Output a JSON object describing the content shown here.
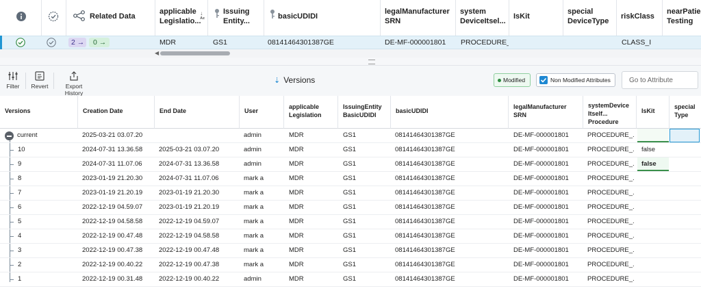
{
  "top_grid": {
    "headers": [
      {
        "label": "",
        "icon": "info-icon"
      },
      {
        "label": "",
        "icon": "check-badge-icon"
      },
      {
        "label": "Related Data",
        "icon": "related-data-icon"
      },
      {
        "label": "applicable Legislatio...",
        "icon": "sort-az-icon"
      },
      {
        "label": "Issuing Entity...",
        "icon": "key-icon"
      },
      {
        "label": "basicUDIDI",
        "icon": "key-icon"
      },
      {
        "label": "legalManufacturer SRN"
      },
      {
        "label": "system DeviceItsel..."
      },
      {
        "label": "IsKit"
      },
      {
        "label": "special DeviceType"
      },
      {
        "label": "riskClass"
      },
      {
        "label": "nearPatien Testing"
      }
    ],
    "row": {
      "status_icon": "check-circle-icon",
      "validated_icon": "check-circle-outline-icon",
      "related_out": "2",
      "related_in": "0",
      "legislation": "MDR",
      "issuing_entity": "GS1",
      "basic_udidi": "08141464301387GE",
      "srn": "DE-MF-000001801",
      "system_device": "PROCEDURE_PA",
      "is_kit": "",
      "special_device_type": "",
      "risk_class": "CLASS_I"
    }
  },
  "toolbar": {
    "filter_label": "Filter",
    "revert_label": "Revert",
    "export_label": "Export History",
    "title": "Versions",
    "modified_label": "Modified",
    "non_modified_label": "Non Modified Attributes",
    "goto_placeholder": "Go to Attribute"
  },
  "versions": {
    "headers": [
      "Versions",
      "Creation Date",
      "End Date",
      "User",
      "applicable Legislation",
      "IssuingEntity BasicUDIDI",
      "basicUDIDI",
      "legalManufacturer SRN",
      "systemDevice Itself... Procedure",
      "IsKit",
      "special Type"
    ],
    "rows": [
      {
        "version": "current",
        "created": "2025-03-21 03.07.20",
        "end": "",
        "user": "admin",
        "leg": "MDR",
        "issuer": "GS1",
        "udidi": "08141464301387GE",
        "srn": "DE-MF-000001801",
        "sys": "PROCEDURE_...",
        "kit": "",
        "special": ""
      },
      {
        "version": "10",
        "created": "2024-07-31 13.36.58",
        "end": "2025-03-21 03.07.20",
        "user": "admin",
        "leg": "MDR",
        "issuer": "GS1",
        "udidi": "08141464301387GE",
        "srn": "DE-MF-000001801",
        "sys": "PROCEDURE_...",
        "kit": "false",
        "special": ""
      },
      {
        "version": "9",
        "created": "2024-07-31 11.07.06",
        "end": "2024-07-31 13.36.58",
        "user": "admin",
        "leg": "MDR",
        "issuer": "GS1",
        "udidi": "08141464301387GE",
        "srn": "DE-MF-000001801",
        "sys": "PROCEDURE_...",
        "kit": "false",
        "special": ""
      },
      {
        "version": "8",
        "created": "2023-01-19 21.20.30",
        "end": "2024-07-31 11.07.06",
        "user": "mark a",
        "leg": "MDR",
        "issuer": "GS1",
        "udidi": "08141464301387GE",
        "srn": "DE-MF-000001801",
        "sys": "PROCEDURE_...",
        "kit": "",
        "special": ""
      },
      {
        "version": "7",
        "created": "2023-01-19 21.20.19",
        "end": "2023-01-19 21.20.30",
        "user": "mark a",
        "leg": "MDR",
        "issuer": "GS1",
        "udidi": "08141464301387GE",
        "srn": "DE-MF-000001801",
        "sys": "PROCEDURE_...",
        "kit": "",
        "special": ""
      },
      {
        "version": "6",
        "created": "2022-12-19 04.59.07",
        "end": "2023-01-19 21.20.19",
        "user": "mark a",
        "leg": "MDR",
        "issuer": "GS1",
        "udidi": "08141464301387GE",
        "srn": "DE-MF-000001801",
        "sys": "PROCEDURE_...",
        "kit": "",
        "special": ""
      },
      {
        "version": "5",
        "created": "2022-12-19 04.58.58",
        "end": "2022-12-19 04.59.07",
        "user": "mark a",
        "leg": "MDR",
        "issuer": "GS1",
        "udidi": "08141464301387GE",
        "srn": "DE-MF-000001801",
        "sys": "PROCEDURE_...",
        "kit": "",
        "special": ""
      },
      {
        "version": "4",
        "created": "2022-12-19 00.47.48",
        "end": "2022-12-19 04.58.58",
        "user": "mark a",
        "leg": "MDR",
        "issuer": "GS1",
        "udidi": "08141464301387GE",
        "srn": "DE-MF-000001801",
        "sys": "PROCEDURE_...",
        "kit": "",
        "special": ""
      },
      {
        "version": "3",
        "created": "2022-12-19 00.47.38",
        "end": "2022-12-19 00.47.48",
        "user": "mark a",
        "leg": "MDR",
        "issuer": "GS1",
        "udidi": "08141464301387GE",
        "srn": "DE-MF-000001801",
        "sys": "PROCEDURE_...",
        "kit": "",
        "special": ""
      },
      {
        "version": "2",
        "created": "2022-12-19 00.40.22",
        "end": "2022-12-19 00.47.38",
        "user": "mark a",
        "leg": "MDR",
        "issuer": "GS1",
        "udidi": "08141464301387GE",
        "srn": "DE-MF-000001801",
        "sys": "PROCEDURE_...",
        "kit": "",
        "special": ""
      },
      {
        "version": "1",
        "created": "2022-12-19 00.31.48",
        "end": "2022-12-19 00.40.22",
        "user": "admin",
        "leg": "MDR",
        "issuer": "GS1",
        "udidi": "08141464301387GE",
        "srn": "DE-MF-000001801",
        "sys": "PROCEDURE_...",
        "kit": "",
        "special": ""
      }
    ]
  },
  "colors": {
    "accent": "#1e88d2",
    "modified_green": "#2e8b3e",
    "selected_row": "#e3f1f9"
  }
}
